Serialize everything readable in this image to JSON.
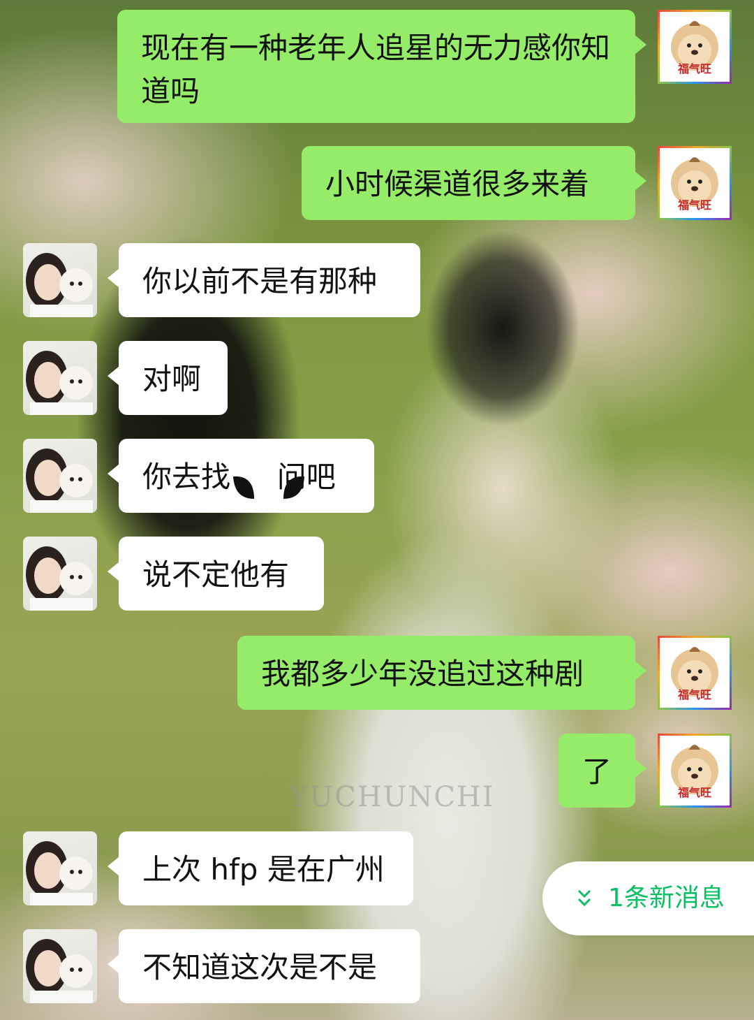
{
  "chat": {
    "messages": [
      {
        "sender": "me",
        "text": "现在有一种老年人追星的无力感你知道吗"
      },
      {
        "sender": "me",
        "text": "小时候渠道很多来着"
      },
      {
        "sender": "them",
        "text": "你以前不是有那种"
      },
      {
        "sender": "them",
        "text": "对啊"
      },
      {
        "sender": "them",
        "text": "你去找     问吧"
      },
      {
        "sender": "them",
        "text": "说不定他有"
      },
      {
        "sender": "me",
        "text": "我都多少年没追过这种剧"
      },
      {
        "sender": "me",
        "text": "了"
      },
      {
        "sender": "them",
        "text": "上次 hfp 是在广州"
      },
      {
        "sender": "them",
        "text": "不知道这次是不是"
      }
    ],
    "my_avatar_caption": "福气旺",
    "new_messages_label": "1条新消息",
    "background_watermark": "YUCHUNCHI"
  },
  "colors": {
    "my_bubble": "#95ec69",
    "their_bubble": "#ffffff",
    "new_message_accent": "#07c160"
  },
  "icons": {
    "new_messages": "chevron-down-icon"
  }
}
